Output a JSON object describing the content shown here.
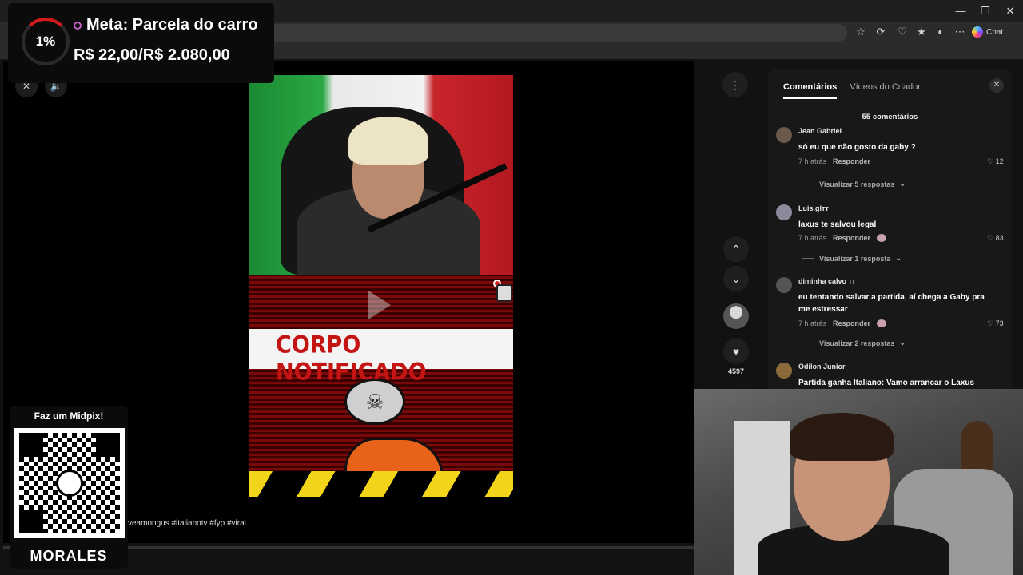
{
  "browser": {
    "chat_label": "Chat",
    "window_controls": [
      "—",
      "❐",
      "✕"
    ]
  },
  "video": {
    "banner_text": "CORPO NOTIFICADO",
    "hashtags": "veamongus #italianotv #fyp #viral",
    "like_count": "4597"
  },
  "comments": {
    "tabs": [
      "Comentários",
      "Vídeos do Criador"
    ],
    "count_label": "55 comentários",
    "reply_label": "Responder",
    "items": [
      {
        "user": "Jean Gabriel",
        "text": "só eu que não gosto da gaby ?",
        "time": "7 h atrás",
        "likes": "12",
        "replies": "Visualizar 5 respostas"
      },
      {
        "user": "Luis.glᴛᴛ",
        "text": "laxus te salvou legal",
        "time": "7 h atrás",
        "likes": "83",
        "replies": "Visualizar 1 resposta"
      },
      {
        "user": "diminha calvo ᴛᴛ",
        "text": "eu tentando salvar a partida, aí chega a Gaby pra me estressar",
        "time": "7 h atrás",
        "likes": "73",
        "replies": "Visualizar 2 respostas"
      },
      {
        "user": "Odilon Junior",
        "text": "Partida ganha Italiano: Vamo arrancar o Laxus"
      }
    ]
  },
  "goal": {
    "percent": "1%",
    "title": "Meta: Parcela do carro",
    "amount": "R$ 22,00/R$ 2.080,00",
    "progress": 0.01
  },
  "pix": {
    "title": "Faz um Midpix!",
    "name": "MORALES"
  },
  "colors": {
    "accent_red": "#d11a1a",
    "banner_red": "#c41414",
    "panel_bg": "#181818"
  }
}
